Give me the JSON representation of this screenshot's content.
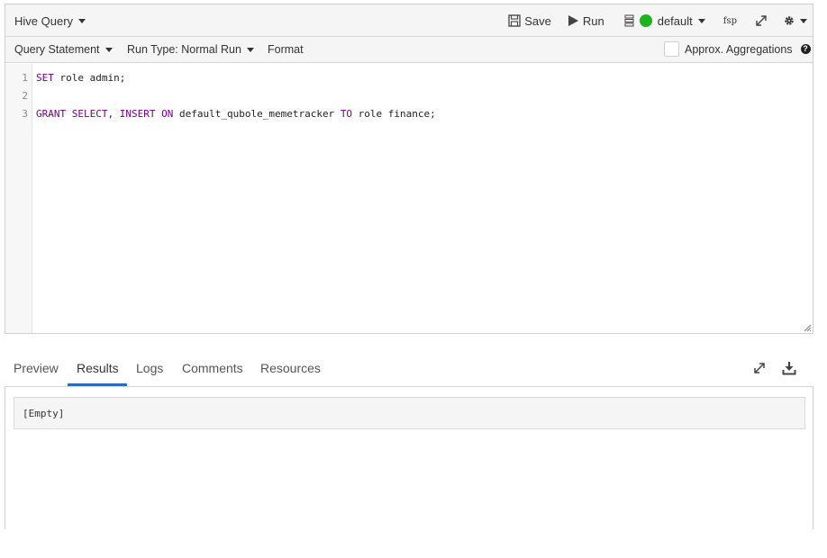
{
  "toolbar": {
    "title": "Hive Query",
    "save_label": "Save",
    "run_label": "Run",
    "cluster_label": "default",
    "fsp_label": "fsp"
  },
  "subbar": {
    "query_statement": "Query Statement",
    "run_type": "Run Type: Normal Run",
    "format": "Format",
    "approx_aggregations": "Approx. Aggregations",
    "help": "?"
  },
  "editor": {
    "lines": [
      {
        "number": "1",
        "tokens": [
          {
            "t": "SET",
            "kw": true
          },
          {
            "t": " role admin;",
            "kw": false
          }
        ]
      },
      {
        "number": "2",
        "tokens": []
      },
      {
        "number": "3",
        "tokens": [
          {
            "t": "GRANT",
            "kw": true
          },
          {
            "t": " ",
            "kw": false
          },
          {
            "t": "SELECT",
            "kw": true
          },
          {
            "t": ", ",
            "kw": false
          },
          {
            "t": "INSERT",
            "kw": true
          },
          {
            "t": " ",
            "kw": false
          },
          {
            "t": "ON",
            "kw": true
          },
          {
            "t": " default_qubole_memetracker ",
            "kw": false
          },
          {
            "t": "TO",
            "kw": true
          },
          {
            "t": " role finance;",
            "kw": false
          }
        ]
      }
    ]
  },
  "tabs": {
    "items": [
      "Preview",
      "Results",
      "Logs",
      "Comments",
      "Resources"
    ],
    "active": "Results"
  },
  "results": {
    "empty_text": "[Empty]"
  },
  "colors": {
    "accent": "#2a6ebb",
    "cluster_status": "#1fb320",
    "keyword": "#770088"
  }
}
